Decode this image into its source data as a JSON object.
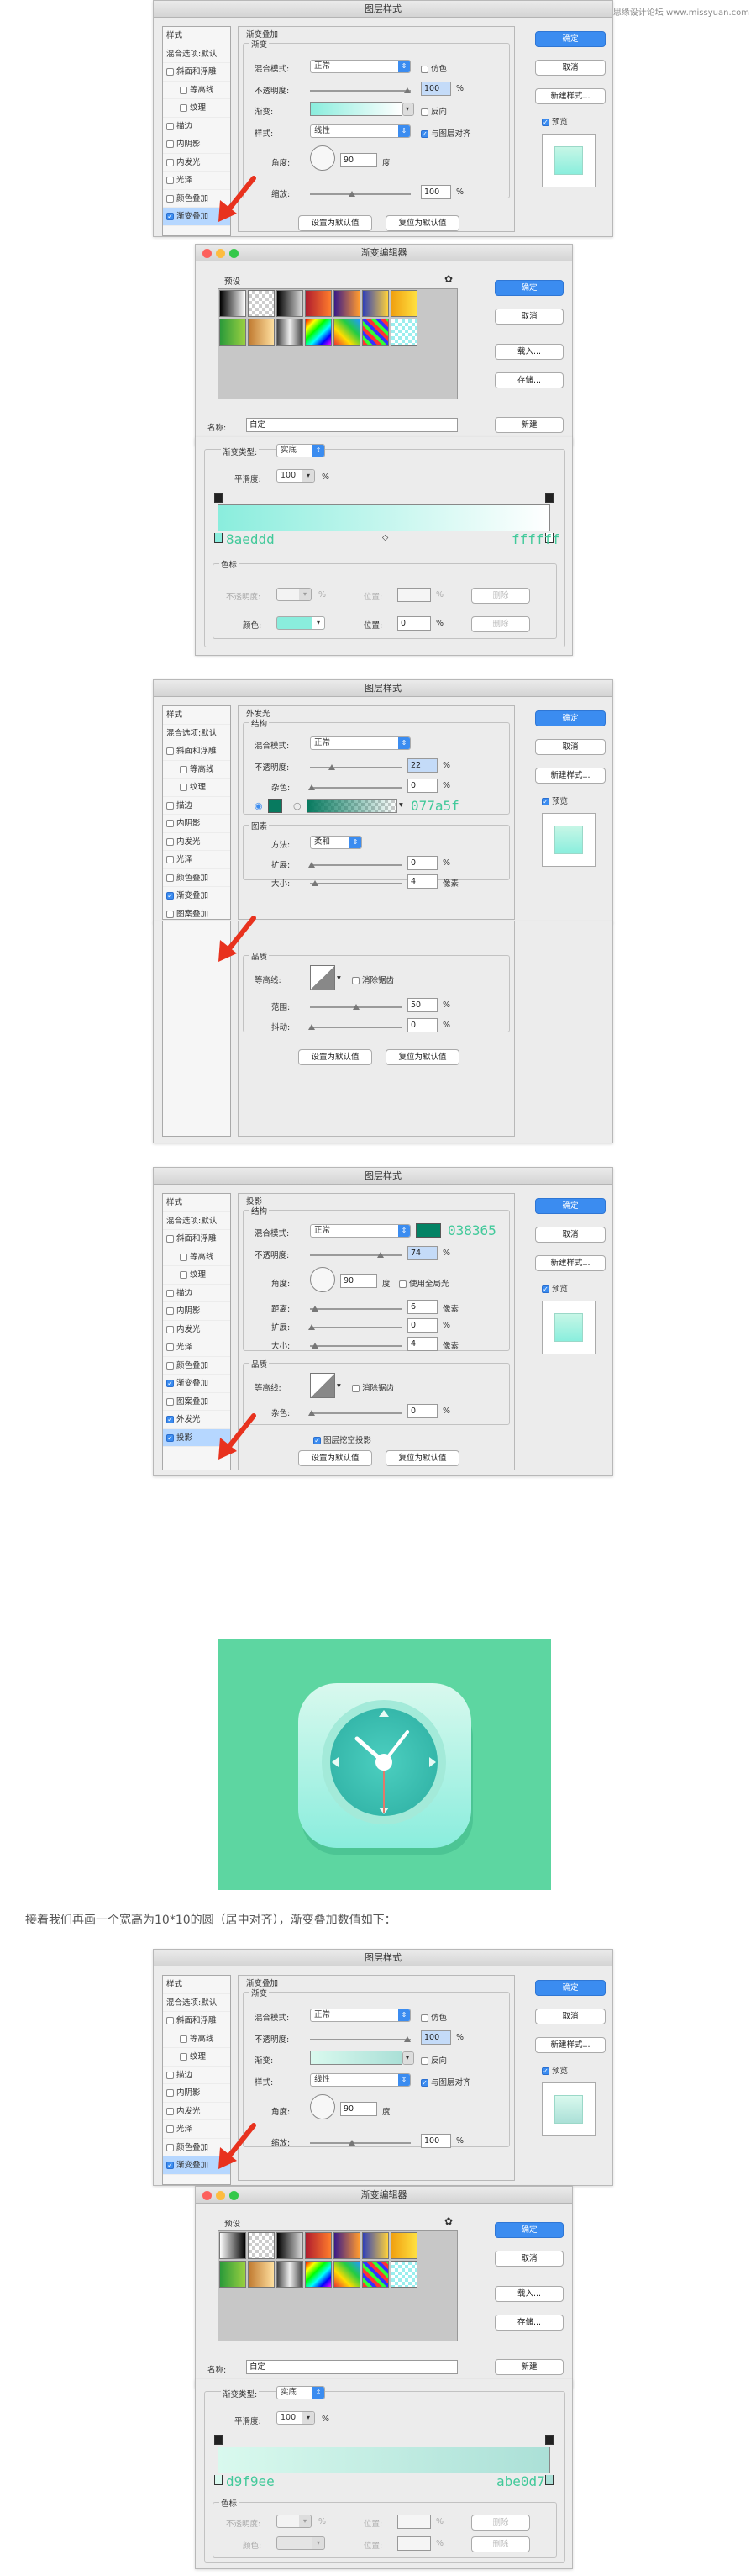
{
  "watermark": "思缘设计论坛 www.missyuan.com",
  "common": {
    "dialog_title": "图层样式",
    "btn_ok": "确定",
    "btn_cancel": "取消",
    "btn_new_style": "新建样式...",
    "preview": "预览",
    "btn_set_default": "设置为默认值",
    "btn_reset_default": "复位为默认值",
    "styles_header": "样式",
    "styles_blend": "混合选项:默认",
    "style_items": [
      "斜面和浮雕",
      "等高线",
      "纹理",
      "描边",
      "内阴影",
      "内发光",
      "光泽",
      "颜色叠加",
      "渐变叠加",
      "图案叠加",
      "外发光",
      "投影"
    ]
  },
  "grad_overlay": {
    "title": "渐变叠加",
    "group": "渐变",
    "blend_mode_label": "混合模式:",
    "blend_mode": "正常",
    "dither": "仿色",
    "opacity_label": "不透明度:",
    "opacity": "100",
    "pct": "%",
    "gradient_label": "渐变:",
    "reverse": "反向",
    "style_label": "样式:",
    "style": "线性",
    "align": "与图层对齐",
    "angle_label": "角度:",
    "angle": "90",
    "degree": "度",
    "scale_label": "缩放:",
    "scale": "100"
  },
  "grad_editor": {
    "title": "渐变编辑器",
    "presets_label": "预设",
    "btn_ok": "确定",
    "btn_cancel": "取消",
    "btn_load": "载入...",
    "btn_save": "存储...",
    "name_label": "名称:",
    "name_value": "自定",
    "btn_new": "新建",
    "type_label": "渐变类型:",
    "type_value": "实底",
    "smooth_label": "平滑度:",
    "smooth_value": "100",
    "stops_title": "色标",
    "stop_opacity_label": "不透明度:",
    "stop_location_label": "位置:",
    "btn_delete": "删除",
    "stop_color_label": "颜色:",
    "stop_location_value": "0"
  },
  "editor1": {
    "left_color": "8aeddd",
    "right_color": "ffffff"
  },
  "editor2": {
    "left_color": "d9f9ee",
    "right_color": "abe0d7"
  },
  "outer_glow": {
    "title": "外发光",
    "structure": "结构",
    "blend_mode_label": "混合模式:",
    "blend_mode": "正常",
    "opacity_label": "不透明度:",
    "opacity": "22",
    "noise_label": "杂色:",
    "noise": "0",
    "color_hex": "077a5f",
    "elements": "图素",
    "technique_label": "方法:",
    "technique": "柔和",
    "spread_label": "扩展:",
    "spread": "0",
    "size_label": "大小:",
    "size": "4",
    "px": "像素",
    "quality": "品质",
    "contour_label": "等高线:",
    "anti_alias": "消除锯齿",
    "range_label": "范围:",
    "range": "50",
    "jitter_label": "抖动:",
    "jitter": "0"
  },
  "drop_shadow": {
    "title": "投影",
    "structure": "结构",
    "blend_mode_label": "混合模式:",
    "blend_mode": "正常",
    "color_hex": "038365",
    "opacity_label": "不透明度:",
    "opacity": "74",
    "angle_label": "角度:",
    "angle": "90",
    "global_light": "使用全局光",
    "distance_label": "距离:",
    "distance": "6",
    "spread_label": "扩展:",
    "spread": "0",
    "size_label": "大小:",
    "size": "4",
    "quality": "品质",
    "contour_label": "等高线:",
    "anti_alias": "消除锯齿",
    "noise_label": "杂色:",
    "noise": "0",
    "knockout": "图层挖空投影"
  },
  "caption": "接着我们再画一个宽高为10*10的圆（居中对齐），渐变叠加数值如下：",
  "colors": {
    "accent": "#3b8cf0",
    "bg_green": "#5dd6a1",
    "glow": "#077a5f",
    "shadow": "#038365",
    "mint": "#8aeddd"
  }
}
